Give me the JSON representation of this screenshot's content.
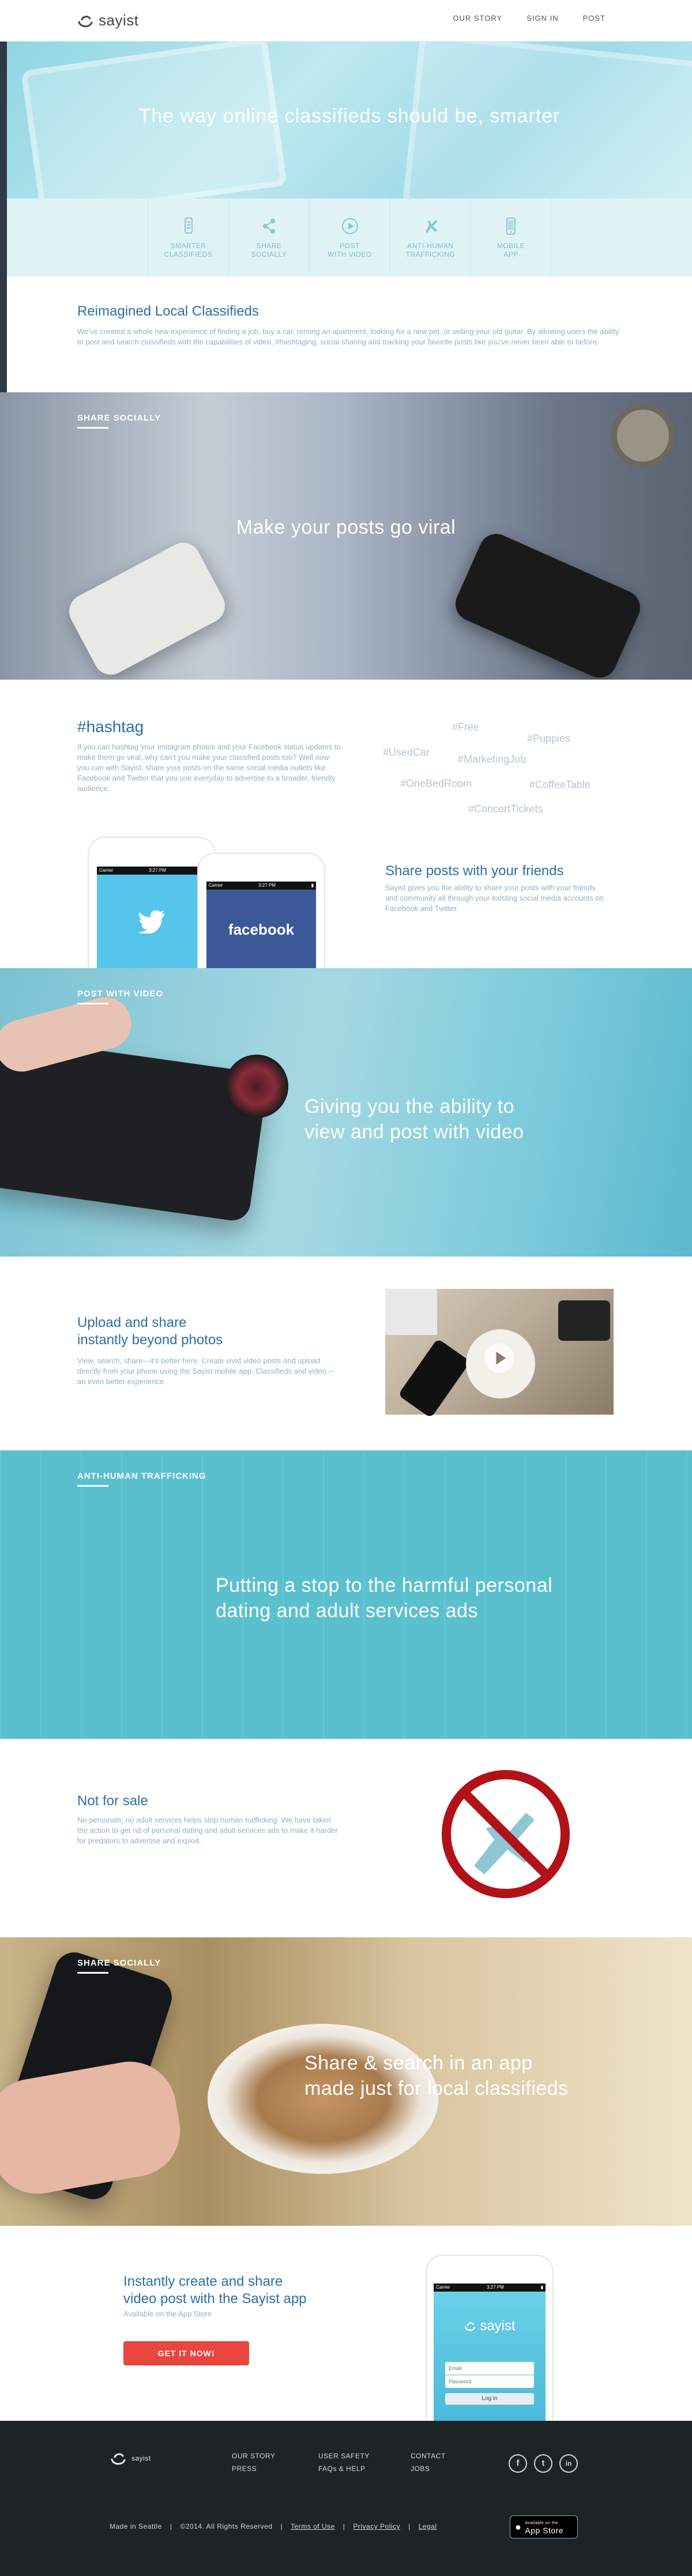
{
  "nav": {
    "brand": "sayist",
    "links": [
      "OUR STORY",
      "SIGN IN",
      "POST"
    ]
  },
  "hero": {
    "headline": "The way online classifieds should be, smarter"
  },
  "features": [
    {
      "label": "SMARTER\nCLASSIFIEDS",
      "icon": "phone-icon"
    },
    {
      "label": "SHARE\nSOCIALLY",
      "icon": "share-icon"
    },
    {
      "label": "POST\nWITH VIDEO",
      "icon": "play-icon"
    },
    {
      "label": "ANTI-HUMAN\nTRAFFICKING",
      "icon": "hand-icon"
    },
    {
      "label": "MOBILE\nAPP",
      "icon": "mobile-icon"
    }
  ],
  "intro": {
    "title": "Reimagined Local Classifieds",
    "body": "We've created a whole new experience of finding a job, buy a car, renting an apartment, looking for a new pet, or selling your old guitar. By allowing users the ability to post and search classifieds with the capabilities of video, #hashtaging, social sharing and tracking your favorite posts like you've never been able to before."
  },
  "share_banner": {
    "tag": "SHARE SOCIALLY",
    "headline": "Make your posts go viral"
  },
  "hashtag_section": {
    "title": "#hashtag",
    "body": "If you can hashtag your Instagram photos and your Facebook status updates to make them go viral, why can't you make your classified posts too? Well now you can with Sayist, share your posts on the same social media outlets like Facebook and Twitter that you use everyday to advertise to a broader, friendly audience.",
    "tags": [
      "#Free",
      "#Puppies",
      "#UsedCar",
      "#MarketingJob",
      "#OneBedRoom",
      "#CoffeeTable",
      "#ConcertTickets"
    ]
  },
  "friends_section": {
    "title": "Share posts with your friends",
    "body": "Sayist gives you the ability to share your posts with your friends and community all through your existing social media accounts on Facebook and Twitter.",
    "phone_left": {
      "carrier": "Carrier",
      "time": "3:27 PM"
    },
    "phone_right": {
      "carrier": "Carrier",
      "time": "3:27 PM",
      "label": "facebook"
    }
  },
  "video_banner": {
    "tag": "POST WITH VIDEO",
    "headline": "Giving you the ability to\nview and post with video"
  },
  "upload_section": {
    "title": "Upload and share\ninstantly beyond photos",
    "body": "View, search, share—it's better here. Create vivid video posts and upload directly from your phone using the Sayist mobile app. Classifieds and video -- an even better experience."
  },
  "traffic_banner": {
    "tag": "ANTI-HUMAN TRAFFICKING",
    "headline": "Putting a stop to the harmful personal\ndating and adult services ads"
  },
  "notforsale_section": {
    "title": "Not for sale",
    "body": "No personals, no adult services helps stop human trafficking. We have taken the action to get rid of personal dating and adult services ads to make it harder for predators to advertise and exploit."
  },
  "app_banner": {
    "tag": "SHARE SOCIALLY",
    "headline": "Share & search in an app\nmade just for local classifieds"
  },
  "app_section": {
    "title": "Instantly create and share\nvideo post with the Sayist app",
    "subtitle": "Available on the App Store",
    "cta": "GET IT NOW!",
    "phone": {
      "carrier": "Carrier",
      "time": "3:27 PM",
      "brand": "sayist",
      "email_placeholder": "Email",
      "password_placeholder": "Password",
      "login": "Log in"
    }
  },
  "footer": {
    "brand": "sayist",
    "col1": [
      "OUR STORY",
      "PRESS"
    ],
    "col2": [
      "USER SAFETY",
      "FAQs & HELP"
    ],
    "col3": [
      "CONTACT",
      "JOBS"
    ],
    "bottom": [
      "Made in Seattle",
      "©2014. All Rights Reserved",
      "Terms of Use",
      "Privacy Policy",
      "Legal"
    ],
    "appstore_small": "Available on the",
    "appstore_big": "App Store",
    "social": [
      "f",
      "t",
      "in"
    ]
  },
  "colors": {
    "accent_blue": "#2e6fa4",
    "cta_red": "#e9463f",
    "teal": "#5ec6d5",
    "footer_bg": "#1e2326"
  }
}
